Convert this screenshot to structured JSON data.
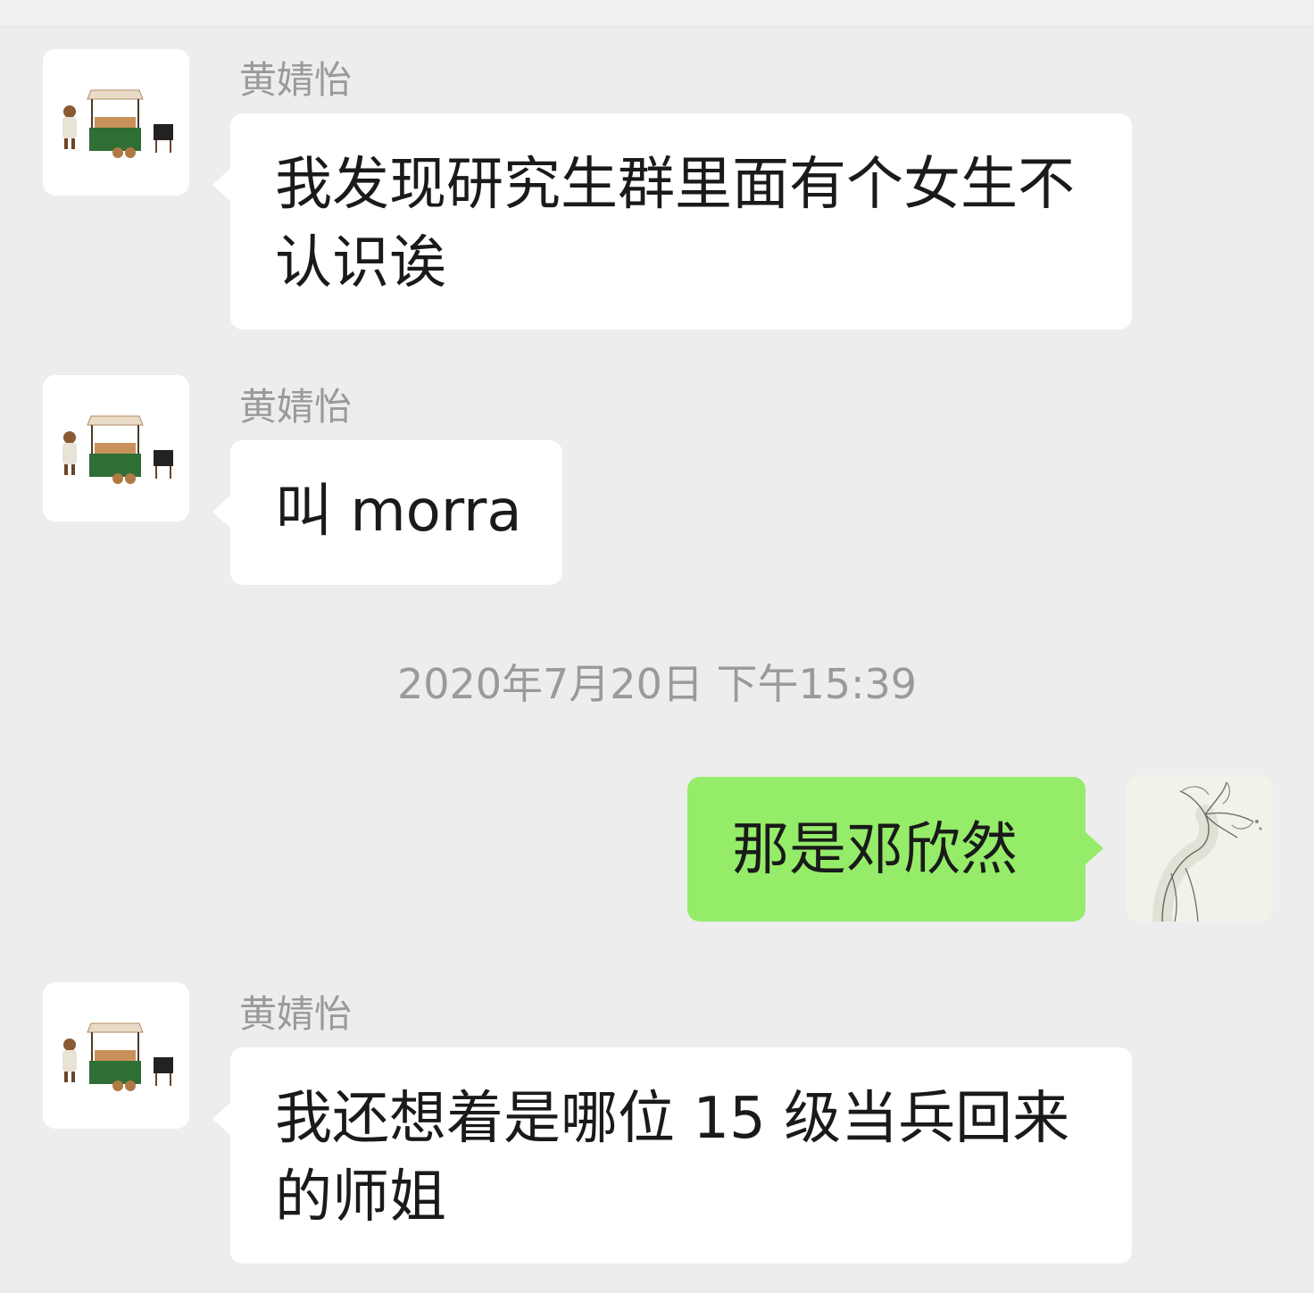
{
  "chat": {
    "messages": [
      {
        "sender": "黄婧怡",
        "text": "我发现研究生群里面有个女生不认识诶",
        "side": "left",
        "avatar_icon": "market-stall-avatar-icon"
      },
      {
        "sender": "黄婧怡",
        "text": "叫 morra",
        "side": "left",
        "avatar_icon": "market-stall-avatar-icon"
      },
      {
        "text": "那是邓欣然",
        "side": "right",
        "avatar_icon": "flower-sketch-avatar-icon"
      },
      {
        "sender": "黄婧怡",
        "text": "我还想着是哪位 15 级当兵回来的师姐",
        "side": "left",
        "avatar_icon": "market-stall-avatar-icon"
      }
    ],
    "timestamp": "2020年7月20日 下午15:39"
  },
  "colors": {
    "background": "#ededed",
    "incoming_bubble": "#ffffff",
    "outgoing_bubble": "#95ec69",
    "meta_text": "#9a9a9a"
  }
}
